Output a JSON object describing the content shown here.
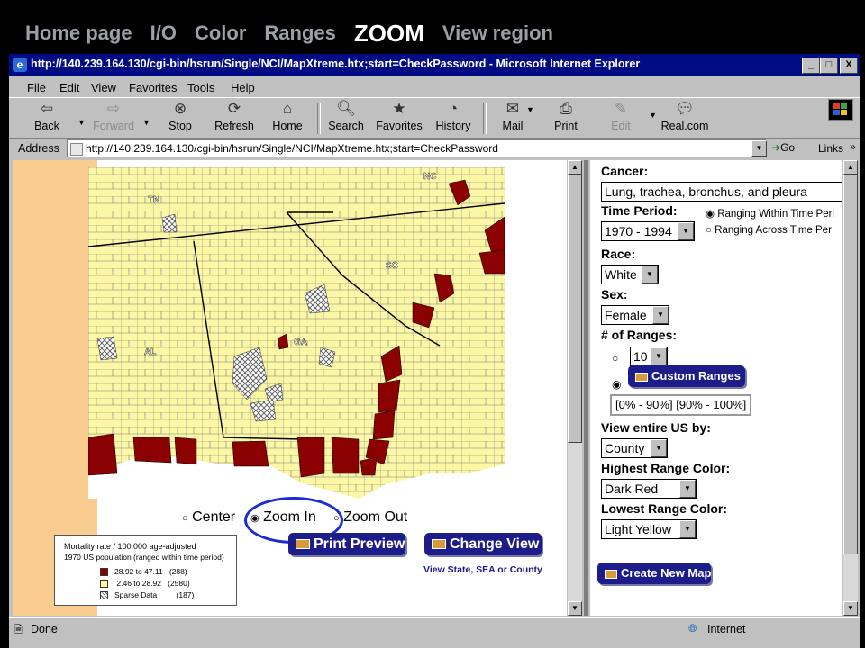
{
  "slide_nav": [
    "Home page",
    "I/O",
    "Color",
    "Ranges",
    "ZOOM",
    "View region"
  ],
  "window": {
    "title": "http://140.239.164.130/cgi-bin/hsrun/Single/NCI/MapXtreme.htx;start=CheckPassword - Microsoft Internet Explorer",
    "controls": [
      "_",
      "□",
      "X"
    ]
  },
  "menu": [
    "File",
    "Edit",
    "View",
    "Favorites",
    "Tools",
    "Help"
  ],
  "toolbar": {
    "back": "Back",
    "forward": "Forward",
    "stop": "Stop",
    "refresh": "Refresh",
    "home": "Home",
    "search": "Search",
    "favorites": "Favorites",
    "history": "History",
    "mail": "Mail",
    "print": "Print",
    "edit": "Edit",
    "real": "Real.com"
  },
  "address": {
    "label": "Address",
    "url": "http://140.239.164.130/cgi-bin/hsrun/Single/NCI/MapXtreme.htx;start=CheckPassword",
    "go": "Go",
    "links": "Links"
  },
  "map": {
    "state_labels": [
      "TN",
      "NC",
      "SC",
      "GA",
      "AL"
    ],
    "zoom_options": {
      "center": "Center",
      "zoom_in": "Zoom In",
      "zoom_out": "Zoom Out",
      "selected": "Zoom In"
    },
    "print_preview": "Print Preview",
    "change_view": "Change View",
    "change_view_note": "View State, SEA or County",
    "legend": {
      "title": "Mortality rate / 100,000 age-adjusted",
      "subtitle": "1970 US population (ranged within time period)",
      "items": [
        {
          "label": "28.92 to 47.11",
          "count": "(288)",
          "color": "#8b0000"
        },
        {
          "label": "2.46 to 28.92",
          "count": "(2580)",
          "color": "#fbf7a4"
        },
        {
          "label": "Sparse Data",
          "count": "(187)",
          "color": "hatched"
        }
      ]
    },
    "colors": {
      "high": "#8b0000",
      "low": "#fbf7a4",
      "peach": "#f9cc8f"
    }
  },
  "form": {
    "cancer_label": "Cancer:",
    "cancer_value": "Lung, trachea, bronchus, and pleura",
    "time_label": "Time Period:",
    "time_value": "1970 - 1994",
    "time_within": "Ranging Within Time Peri",
    "time_across": "Ranging Across Time Per",
    "race_label": "Race:",
    "race_value": "White",
    "sex_label": "Sex:",
    "sex_value": "Female",
    "ranges_label": "# of Ranges:",
    "ranges_value": "10",
    "custom_ranges": "Custom Ranges",
    "ranges_text": "[0% - 90%] [90% - 100%]",
    "view_us_label": "View entire US by:",
    "view_us_value": "County",
    "highest_label": "Highest Range Color:",
    "highest_value": "Dark Red",
    "lowest_label": "Lowest Range Color:",
    "lowest_value": "Light Yellow",
    "create_map": "Create New Map"
  },
  "status": {
    "done": "Done",
    "zone": "Internet"
  }
}
